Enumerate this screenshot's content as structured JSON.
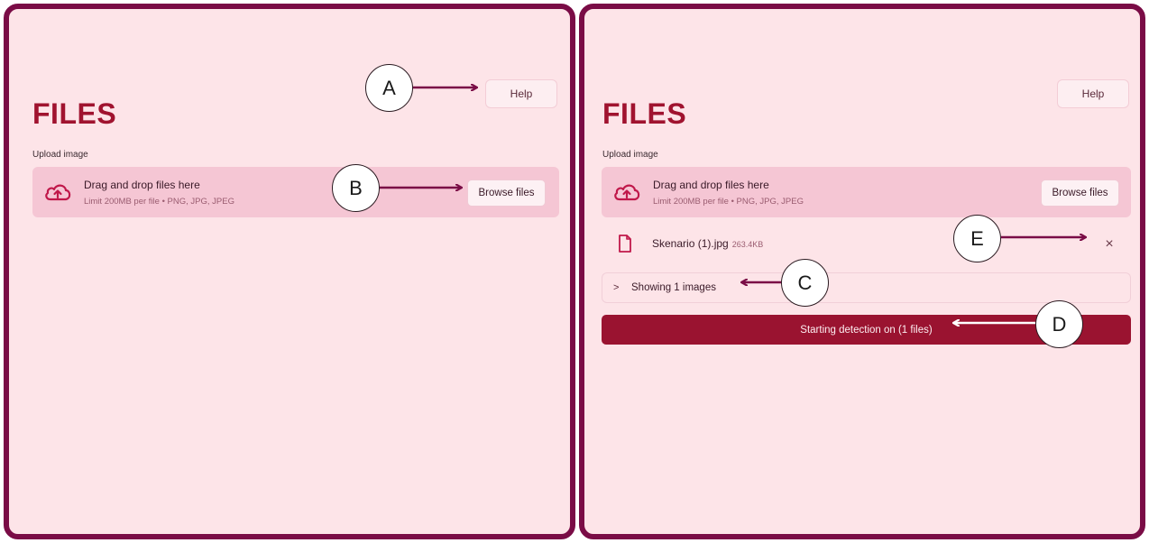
{
  "colors": {
    "frame": "#7a0c46",
    "panel_bg": "#fde4e8",
    "accent": "#a0132f",
    "dropzone_bg": "#f5c6d4",
    "primary_button": "#9a1330"
  },
  "left_panel": {
    "help_label": "Help",
    "title": "FILES",
    "upload_label": "Upload image",
    "dropzone": {
      "icon": "cloud-upload-icon",
      "title": "Drag and drop files here",
      "limit": "Limit 200MB per file • PNG, JPG, JPEG",
      "browse_label": "Browse files"
    }
  },
  "right_panel": {
    "help_label": "Help",
    "title": "FILES",
    "upload_label": "Upload image",
    "dropzone": {
      "icon": "cloud-upload-icon",
      "title": "Drag and drop files here",
      "limit": "Limit 200MB per file • PNG, JPG, JPEG",
      "browse_label": "Browse files"
    },
    "uploaded_file": {
      "icon": "file-icon",
      "name": "Skenario (1).jpg",
      "size": "263.4KB",
      "remove": "×"
    },
    "expander": {
      "chevron": ">",
      "label": "Showing 1 images"
    },
    "detect_button": "Starting detection on (1 files)"
  },
  "callouts": {
    "a": "A",
    "b": "B",
    "c": "C",
    "d": "D",
    "e": "E"
  }
}
